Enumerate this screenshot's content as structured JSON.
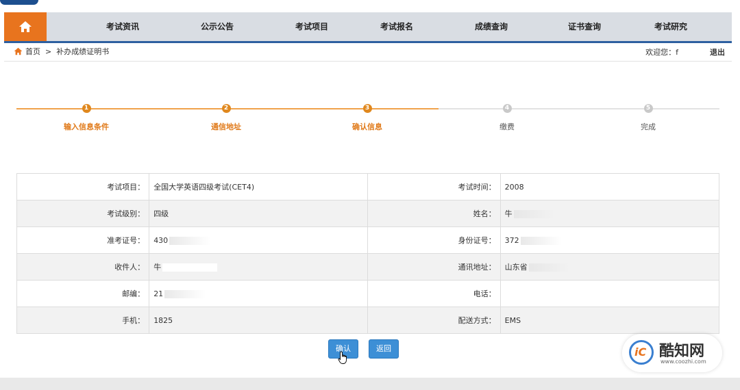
{
  "nav": {
    "items": [
      "考试资讯",
      "公示公告",
      "考试项目",
      "考试报名",
      "成绩查询",
      "证书查询",
      "考试研究"
    ]
  },
  "breadcrumb": {
    "home": "首页",
    "separator": ">",
    "current": "补办成绩证明书"
  },
  "user": {
    "welcome": "欢迎您：f",
    "logout": "退出"
  },
  "steps": [
    {
      "num": "1",
      "label": "输入信息条件",
      "state": "done"
    },
    {
      "num": "2",
      "label": "通信地址",
      "state": "done"
    },
    {
      "num": "3",
      "label": "确认信息",
      "state": "current"
    },
    {
      "num": "4",
      "label": "缴费",
      "state": "pending"
    },
    {
      "num": "5",
      "label": "完成",
      "state": "pending"
    }
  ],
  "info": {
    "rows": [
      {
        "k1": "考试项目：",
        "v1": "全国大学英语四级考试(CET4)",
        "k2": "考试时间：",
        "v2": "2008"
      },
      {
        "k1": "考试级别：",
        "v1": "四级",
        "k2": "姓名：",
        "v2": "牛"
      },
      {
        "k1": "准考证号：",
        "v1": "430",
        "k2": "身份证号：",
        "v2": "372"
      },
      {
        "k1": "收件人：",
        "v1": "牛",
        "k2": "通讯地址：",
        "v2": "山东省"
      },
      {
        "k1": "邮编：",
        "v1": "21",
        "k2": "电话：",
        "v2": ""
      },
      {
        "k1": "手机：",
        "v1": "1825",
        "k2": "配送方式：",
        "v2": "EMS"
      }
    ]
  },
  "buttons": {
    "confirm": "确认",
    "back": "返回"
  },
  "watermark": {
    "title": "酷知网",
    "url": "www.coozhi.com"
  },
  "colors": {
    "accent_orange": "#e8741e",
    "nav_bg": "#d9dde3",
    "nav_border": "#2d5fa0",
    "button_blue": "#3d8fd6"
  }
}
